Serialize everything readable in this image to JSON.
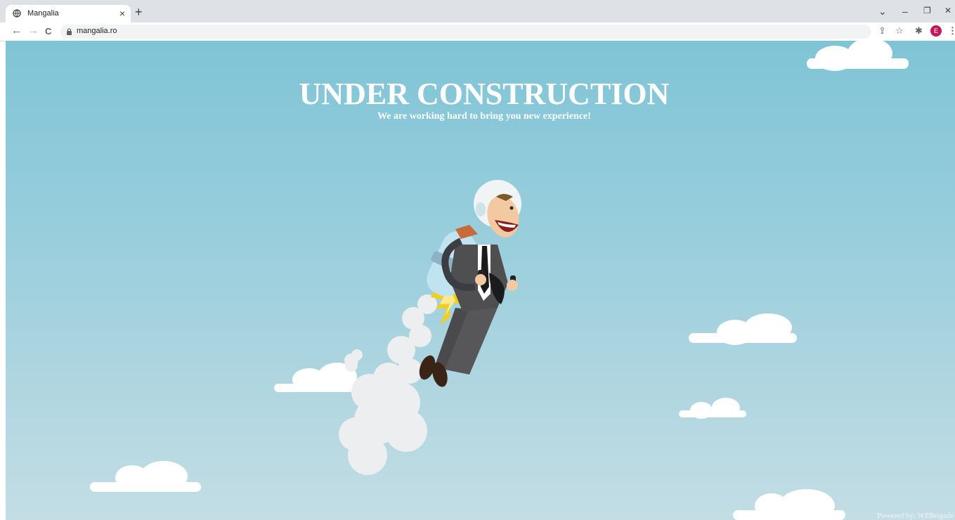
{
  "browser": {
    "tab_title": "Mangalia",
    "tab_close": "×",
    "new_tab": "+",
    "url": "mangalia.ro",
    "avatar_letter": "E",
    "window_controls": {
      "dropdown": "⌄",
      "minimize": "–",
      "restore": "❐",
      "close": "✕"
    },
    "nav": {
      "back": "←",
      "forward": "→",
      "reload": "C"
    },
    "icons": {
      "share": "⇪",
      "star": "☆",
      "extensions": "✱",
      "menu": "⋮"
    }
  },
  "page": {
    "headline": "UNDER CONSTRUCTION",
    "subtitle": "We are working hard to bring you new experience!",
    "credit_prefix": "Powered by:",
    "credit_name": "WPBrigade"
  },
  "colors": {
    "sky_top": "#7fc4d6",
    "sky_bottom": "#c4dde4",
    "tabstrip": "#dee1e6",
    "avatar": "#c2185b"
  }
}
